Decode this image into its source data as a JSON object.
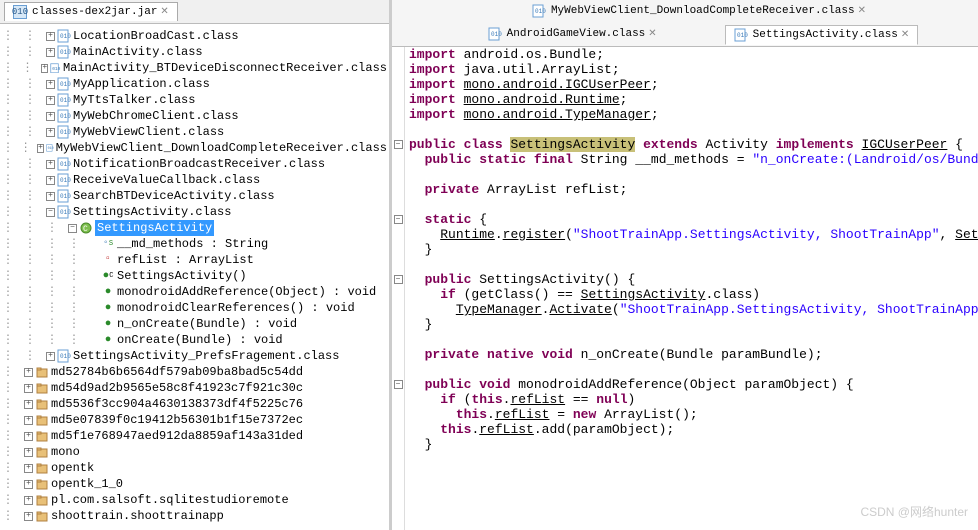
{
  "leftTab": "classes-dex2jar.jar",
  "tree": [
    {
      "d": 2,
      "t": "+",
      "ic": "cls",
      "label": "LocationBroadCast.class"
    },
    {
      "d": 2,
      "t": "+",
      "ic": "cls",
      "label": "MainActivity.class"
    },
    {
      "d": 2,
      "t": "+",
      "ic": "cls",
      "label": "MainActivity_BTDeviceDisconnectReceiver.class"
    },
    {
      "d": 2,
      "t": "+",
      "ic": "cls",
      "label": "MyApplication.class"
    },
    {
      "d": 2,
      "t": "+",
      "ic": "cls",
      "label": "MyTtsTalker.class"
    },
    {
      "d": 2,
      "t": "+",
      "ic": "cls",
      "label": "MyWebChromeClient.class"
    },
    {
      "d": 2,
      "t": "+",
      "ic": "cls",
      "label": "MyWebViewClient.class"
    },
    {
      "d": 2,
      "t": "+",
      "ic": "cls",
      "label": "MyWebViewClient_DownloadCompleteReceiver.class"
    },
    {
      "d": 2,
      "t": "+",
      "ic": "cls",
      "label": "NotificationBroadcastReceiver.class"
    },
    {
      "d": 2,
      "t": "+",
      "ic": "cls",
      "label": "ReceiveValueCallback.class"
    },
    {
      "d": 2,
      "t": "+",
      "ic": "cls",
      "label": "SearchBTDeviceActivity.class"
    },
    {
      "d": 2,
      "t": "-",
      "ic": "cls",
      "label": "SettingsActivity.class"
    },
    {
      "d": 3,
      "t": "-",
      "ic": "clsg",
      "label": "SettingsActivity",
      "sel": true
    },
    {
      "d": 4,
      "t": "",
      "ic": "sf",
      "label": "__md_methods : String"
    },
    {
      "d": 4,
      "t": "",
      "ic": "fr",
      "label": "refList : ArrayList"
    },
    {
      "d": 4,
      "t": "",
      "ic": "mc",
      "label": "SettingsActivity()"
    },
    {
      "d": 4,
      "t": "",
      "ic": "mp",
      "label": "monodroidAddReference(Object) : void"
    },
    {
      "d": 4,
      "t": "",
      "ic": "mp",
      "label": "monodroidClearReferences() : void"
    },
    {
      "d": 4,
      "t": "",
      "ic": "mp",
      "label": "n_onCreate(Bundle) : void"
    },
    {
      "d": 4,
      "t": "",
      "ic": "mp",
      "label": "onCreate(Bundle) : void"
    },
    {
      "d": 2,
      "t": "+",
      "ic": "cls",
      "label": "SettingsActivity_PrefsFragement.class"
    },
    {
      "d": 1,
      "t": "+",
      "ic": "pkg",
      "label": "md52784b6b6564df579ab09ba8bad5c54dd"
    },
    {
      "d": 1,
      "t": "+",
      "ic": "pkg",
      "label": "md54d9ad2b9565e58c8f41923c7f921c30c"
    },
    {
      "d": 1,
      "t": "+",
      "ic": "pkg",
      "label": "md5536f3cc904a4630138373df4f5225c76"
    },
    {
      "d": 1,
      "t": "+",
      "ic": "pkg",
      "label": "md5e07839f0c19412b56301b1f15e7372ec"
    },
    {
      "d": 1,
      "t": "+",
      "ic": "pkg",
      "label": "md5f1e768947aed912da8859af143a31ded"
    },
    {
      "d": 1,
      "t": "+",
      "ic": "pkg",
      "label": "mono"
    },
    {
      "d": 1,
      "t": "+",
      "ic": "pkg",
      "label": "opentk"
    },
    {
      "d": 1,
      "t": "+",
      "ic": "pkg",
      "label": "opentk_1_0"
    },
    {
      "d": 1,
      "t": "+",
      "ic": "pkg",
      "label": "pl.com.salsoft.sqlitestudioremote"
    },
    {
      "d": 1,
      "t": "+",
      "ic": "pkg",
      "label": "shoottrain.shoottrainapp"
    }
  ],
  "rightTabsTop": [
    {
      "label": "MyWebViewClient_DownloadCompleteReceiver.class",
      "active": false
    }
  ],
  "rightTabsBot": [
    {
      "label": "AndroidGameView.class",
      "active": false
    },
    {
      "label": "SettingsActivity.class",
      "active": true
    }
  ],
  "code": {
    "lines": [
      {
        "f": "",
        "h": "<span class=\"kw\">import</span> android.os.Bundle;"
      },
      {
        "f": "",
        "h": "<span class=\"kw\">import</span> java.util.ArrayList;"
      },
      {
        "f": "",
        "h": "<span class=\"kw\">import</span> <span class=\"und\">mono.android.IGCUserPeer</span>;"
      },
      {
        "f": "",
        "h": "<span class=\"kw\">import</span> <span class=\"und\">mono.android.Runtime</span>;"
      },
      {
        "f": "",
        "h": "<span class=\"kw\">import</span> <span class=\"und\">mono.android.TypeManager</span>;"
      },
      {
        "f": "",
        "h": ""
      },
      {
        "f": "-",
        "h": "<span class=\"kw\">public</span> <span class=\"kw\">class</span> <span class=\"hl\">SettingsActivity</span> <span class=\"kw\">extends</span> Activity <span class=\"kw\">implements</span> <span class=\"und\">IGCUserPeer</span> {"
      },
      {
        "f": "",
        "h": "  <span class=\"kw\">public</span> <span class=\"kw\">static</span> <span class=\"kw\">final</span> String __md_methods = <span class=\"str\">\"n_onCreate:(Landroid/os/Bundle;</span>"
      },
      {
        "f": "",
        "h": "  "
      },
      {
        "f": "",
        "h": "  <span class=\"kw\">private</span> ArrayList refList;"
      },
      {
        "f": "",
        "h": "  "
      },
      {
        "f": "-",
        "h": "  <span class=\"kw\">static</span> {"
      },
      {
        "f": "",
        "h": "    <span class=\"und\">Runtime</span>.<span class=\"und\">register</span>(<span class=\"str\">\"ShootTrainApp.SettingsActivity, ShootTrainApp\"</span>, <span class=\"und\">Settir</span>"
      },
      {
        "f": "",
        "h": "  }"
      },
      {
        "f": "",
        "h": "  "
      },
      {
        "f": "-",
        "h": "  <span class=\"kw\">public</span> SettingsActivity() {"
      },
      {
        "f": "",
        "h": "    <span class=\"kw\">if</span> (getClass() == <span class=\"und\">SettingsActivity</span>.class)"
      },
      {
        "f": "",
        "h": "      <span class=\"und\">TypeManager</span>.<span class=\"und\">Activate</span>(<span class=\"str\">\"ShootTrainApp.SettingsActivity, ShootTrainApp\"</span>, "
      },
      {
        "f": "",
        "h": "  }"
      },
      {
        "f": "",
        "h": "  "
      },
      {
        "f": "",
        "h": "  <span class=\"kw\">private</span> <span class=\"kw\">native</span> <span class=\"kw\">void</span> n_onCreate(Bundle paramBundle);"
      },
      {
        "f": "",
        "h": "  "
      },
      {
        "f": "-",
        "h": "  <span class=\"kw\">public</span> <span class=\"kw\">void</span> monodroidAddReference(Object paramObject) {"
      },
      {
        "f": "",
        "h": "    <span class=\"kw\">if</span> (<span class=\"kw\">this</span>.<span class=\"und\">refList</span> == <span class=\"kw\">null</span>)"
      },
      {
        "f": "",
        "h": "      <span class=\"kw\">this</span>.<span class=\"und\">refList</span> = <span class=\"kw\">new</span> ArrayList(); "
      },
      {
        "f": "",
        "h": "    <span class=\"kw\">this</span>.<span class=\"und\">refList</span>.add(paramObject);"
      },
      {
        "f": "",
        "h": "  }"
      }
    ]
  },
  "watermark": "CSDN @网络hunter"
}
